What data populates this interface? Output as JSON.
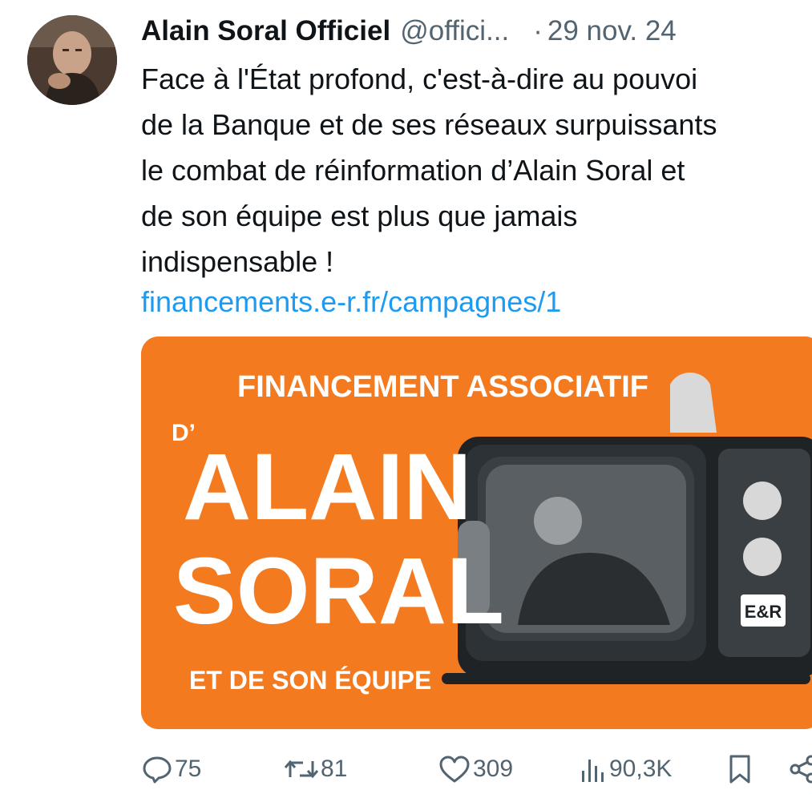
{
  "tweet": {
    "author_name": "Alain Soral Officiel",
    "handle": "@offici...",
    "separator": "·",
    "date": "29 nov. 24",
    "text": "Face à l'État profond, c'est-à-dire au pouvoi\nde la Banque et de ses réseaux surpuissants\nle combat de réinformation d’Alain Soral et\nde son équipe est plus que jamais\nindispensable !",
    "link": "financements.e-r.fr/campagnes/1"
  },
  "media": {
    "headline": "FINANCEMENT ASSOCIATIF",
    "prefix": "D’",
    "name_line1": "ALAIN",
    "name_line2": "SORAL",
    "footer": "ET DE SON ÉQUIPE",
    "tv_badge": "E&R",
    "background_color": "#f47a20"
  },
  "actions": {
    "replies": "75",
    "reposts": "81",
    "likes": "309",
    "views": "90,3K"
  },
  "icons": {
    "reply": "reply-icon",
    "repost": "repost-icon",
    "like": "heart-icon",
    "views": "views-icon",
    "bookmark": "bookmark-icon",
    "share": "share-icon"
  },
  "colors": {
    "text": "#0f1419",
    "secondary": "#536471",
    "link": "#1d9bf0",
    "accent_orange": "#f47a20"
  }
}
